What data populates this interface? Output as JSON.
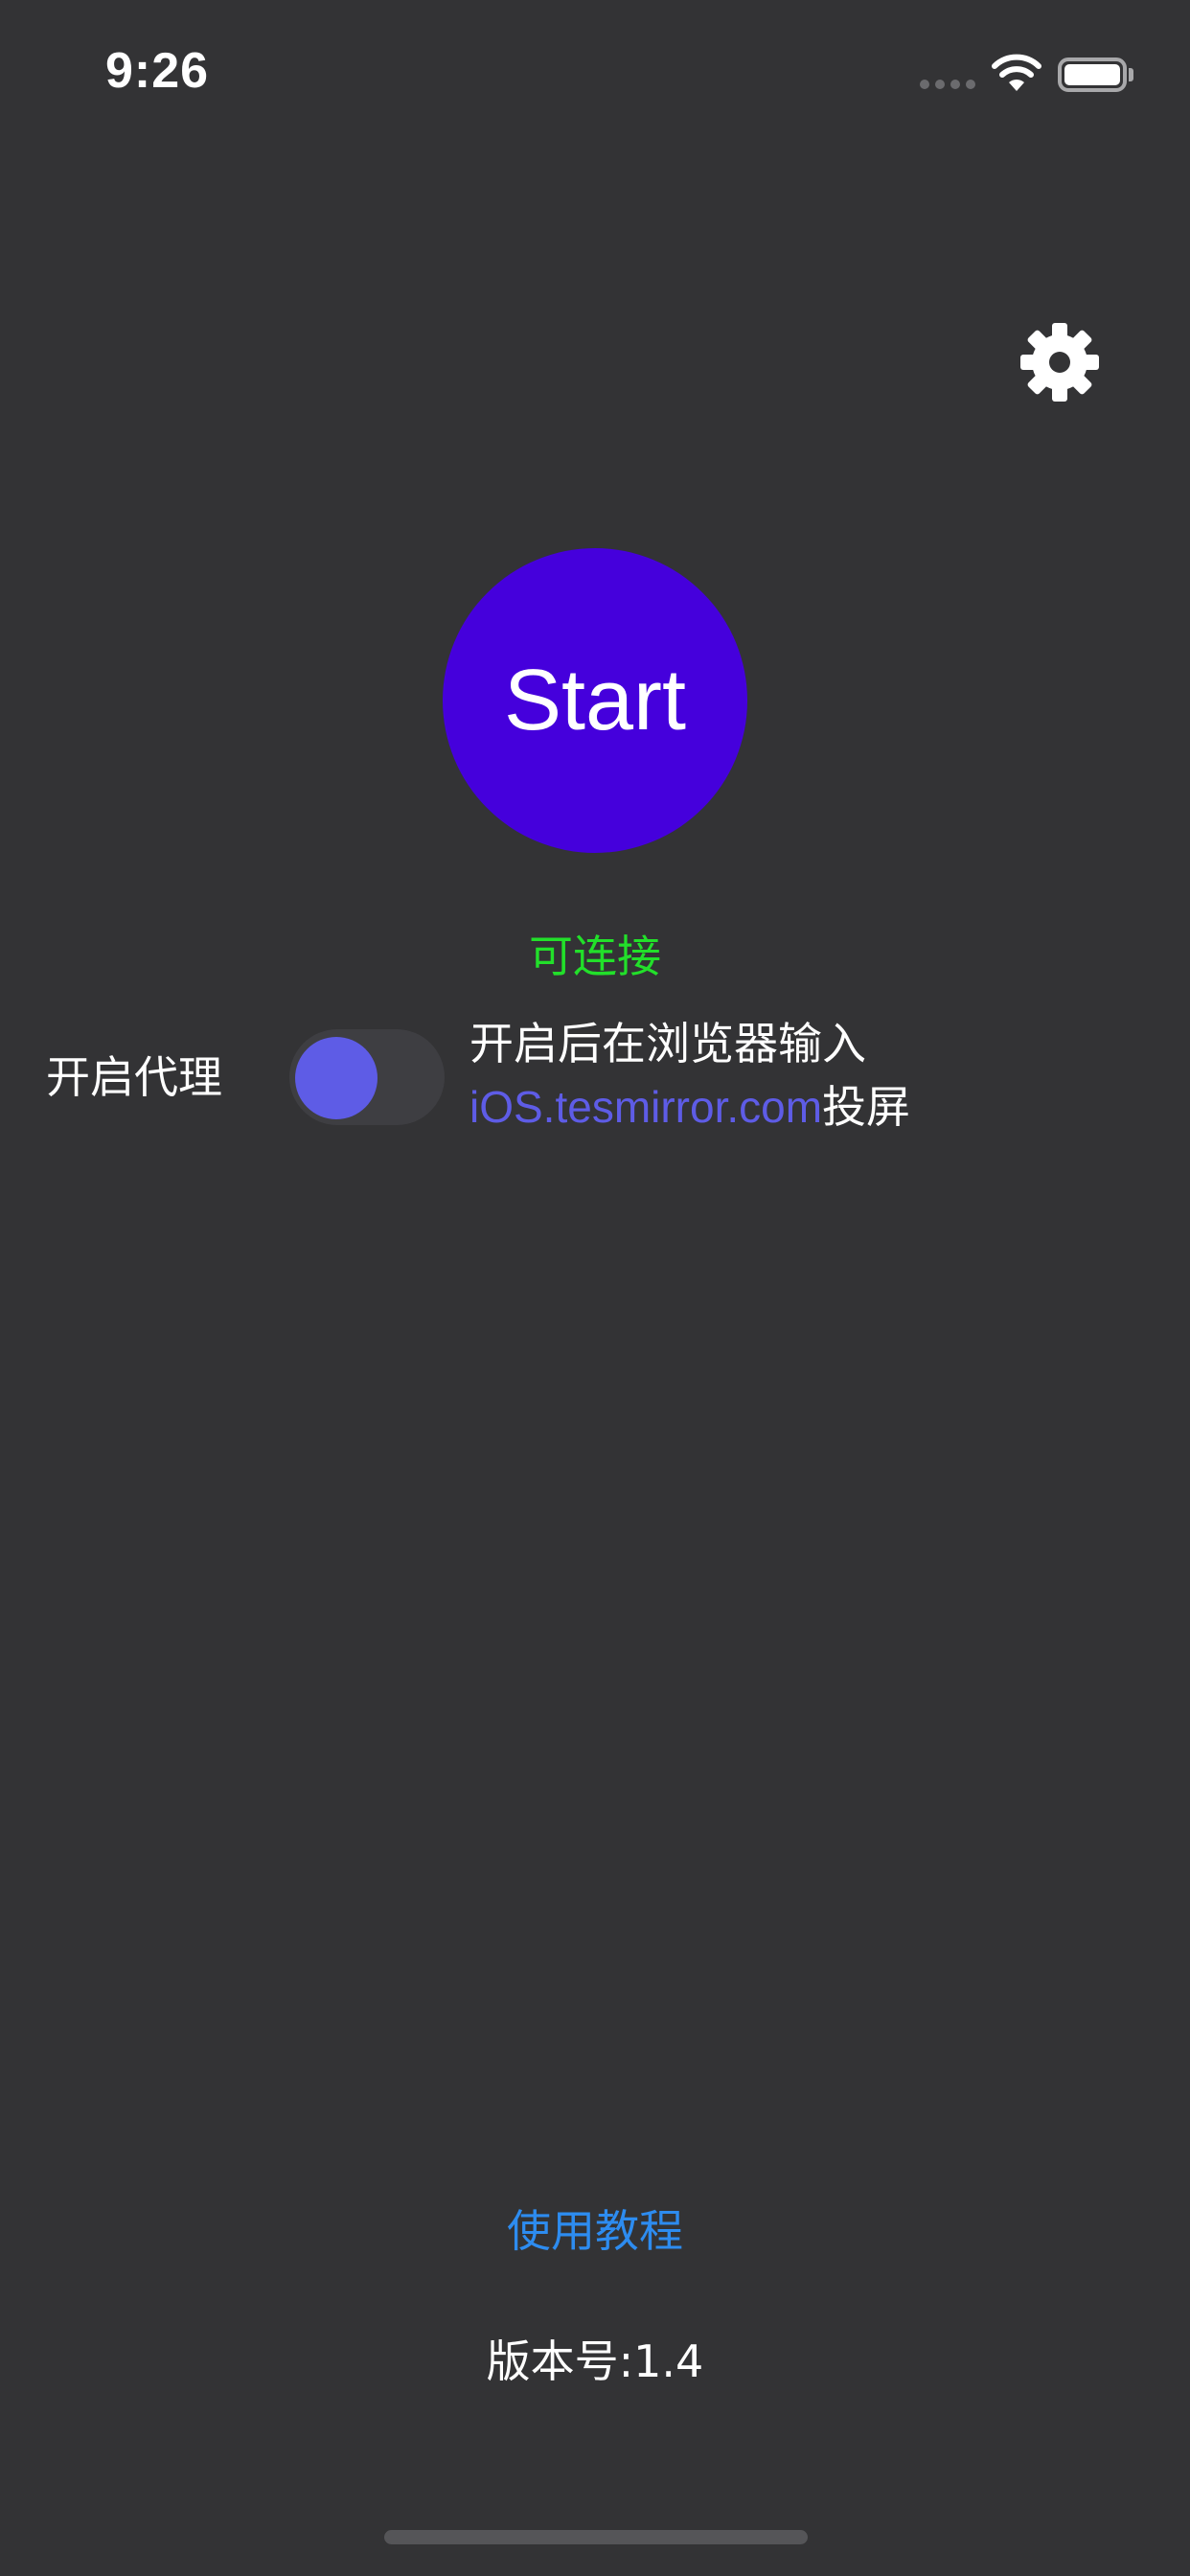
{
  "status_bar": {
    "time": "9:26"
  },
  "icons": {
    "settings": "gear-icon",
    "wifi": "wifi-icon",
    "battery": "battery-icon",
    "signal": "signal-icon"
  },
  "main": {
    "start_label": "Start",
    "status": "可连接"
  },
  "proxy": {
    "label": "开启代理",
    "toggle_on": false,
    "hint_line1": "开启后在浏览器输入",
    "hint_link": "iOS.tesmirror.com",
    "hint_suffix": "投屏"
  },
  "footer": {
    "tutorial": "使用教程",
    "version": "版本号:1.4"
  },
  "colors": {
    "background": "#333335",
    "start_button": "#4500dc",
    "status_green": "#22e02a",
    "link_indigo": "#5e5ce6",
    "link_blue": "#2d8cf0"
  }
}
